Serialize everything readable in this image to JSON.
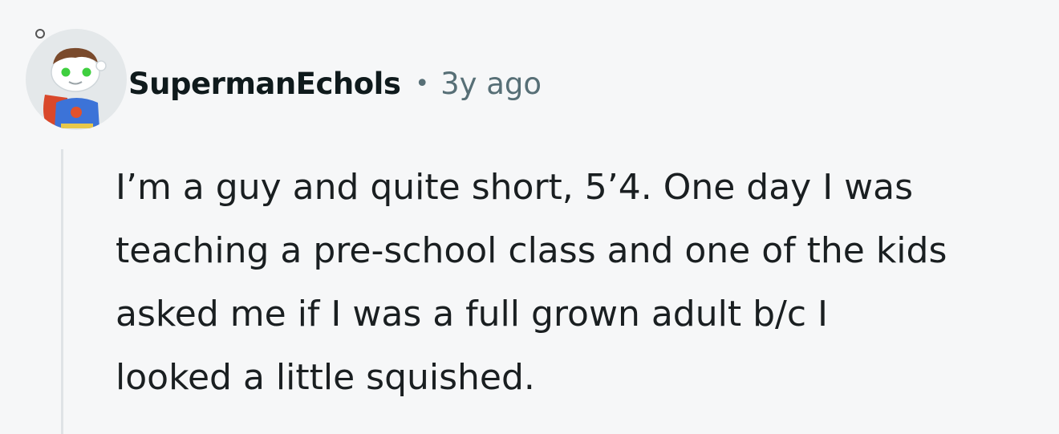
{
  "comment": {
    "author": "SupermanEchols",
    "separator": "•",
    "timestamp": "3y ago",
    "avatar_icon": "snoo-superman-avatar-icon",
    "body_lines": [
      "I’m a guy and quite short, 5’4. One day I was",
      "teaching a pre-school class and one of the kids",
      "asked me if I was a full grown adult b/c I",
      "looked a little squished."
    ]
  },
  "colors": {
    "background": "#f6f7f8",
    "author": "#0f1a1c",
    "meta": "#576f76",
    "body": "#1a1f21",
    "thread_line": "#dfe3e6"
  }
}
